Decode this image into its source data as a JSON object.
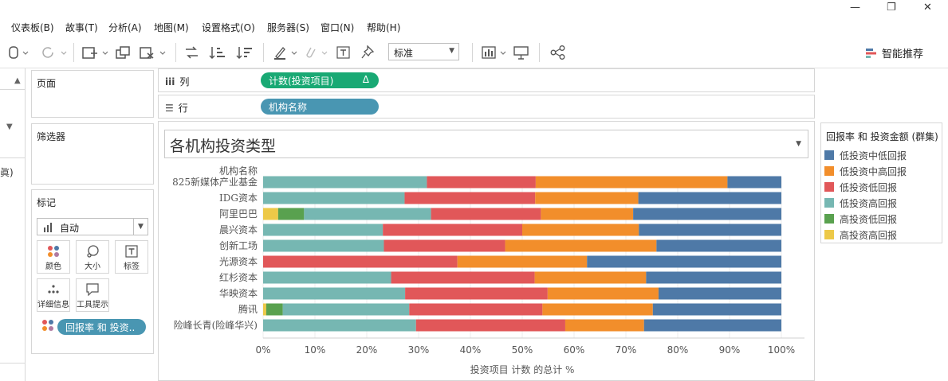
{
  "menu": [
    "仪表板(B)",
    "故事(T)",
    "分析(A)",
    "地图(M)",
    "设置格式(O)",
    "服务器(S)",
    "窗口(N)",
    "帮助(H)"
  ],
  "window_controls": [
    "—",
    "❐",
    "✕"
  ],
  "toolbar": {
    "mark_type_select": "标准",
    "smart_label": "智能推荐"
  },
  "left_strip": {
    "label": "眞)"
  },
  "panels": {
    "pages_title": "页面",
    "filters_title": "筛选器",
    "marks_title": "标记",
    "marks_type": "自动",
    "mark_buttons": [
      "颜色",
      "大小",
      "标签",
      "详细信息",
      "工具提示"
    ],
    "marks_pill": "回报率 和 投资.."
  },
  "shelves": {
    "columns_label": "列",
    "columns_pill": "计数(投资项目)",
    "columns_pill_delta": "Δ",
    "rows_label": "行",
    "rows_pill": "机构名称"
  },
  "viz": {
    "title": "各机构投资类型"
  },
  "legend": {
    "title": "回报率 和 投资金额 (群集)",
    "items": [
      {
        "label": "低投资中低回报",
        "color": "#4e79a7"
      },
      {
        "label": "低投资中高回报",
        "color": "#f28e2b"
      },
      {
        "label": "低投资低回报",
        "color": "#e15759"
      },
      {
        "label": "低投资高回报",
        "color": "#76b7b2"
      },
      {
        "label": "高投资低回报",
        "color": "#59a14f"
      },
      {
        "label": "高投资高回报",
        "color": "#edc948"
      }
    ]
  },
  "chart_data": {
    "type": "bar",
    "orientation": "horizontal",
    "stacked": "percent",
    "row_header": "机构名称",
    "xlabel": "投资项目 计数 的总计 %",
    "xlim": [
      0,
      100
    ],
    "x_ticks": [
      "0%",
      "10%",
      "20%",
      "30%",
      "40%",
      "50%",
      "60%",
      "70%",
      "80%",
      "90%",
      "100%"
    ],
    "categories": [
      "825新媒体产业基金",
      "IDG资本",
      "阿里巴巴",
      "晨兴资本",
      "创新工场",
      "光源资本",
      "红杉资本",
      "华映资本",
      "腾讯",
      "险峰长青(险峰华兴)"
    ],
    "stack_order": [
      "高投资高回报",
      "高投资低回报",
      "低投资高回报",
      "低投资低回报",
      "低投资中高回报",
      "低投资中低回报"
    ],
    "series": [
      {
        "name": "高投资高回报",
        "color": "#edc948",
        "values": [
          0,
          0,
          2.9,
          0,
          0,
          0,
          0,
          0,
          0.6,
          0
        ]
      },
      {
        "name": "高投资低回报",
        "color": "#59a14f",
        "values": [
          0,
          0,
          5.0,
          0,
          0,
          0,
          0,
          0,
          3.2,
          0
        ]
      },
      {
        "name": "低投资高回报",
        "color": "#76b7b2",
        "values": [
          31.6,
          27.3,
          24.5,
          23.1,
          23.3,
          0,
          24.7,
          27.4,
          24.4,
          29.5
        ]
      },
      {
        "name": "低投资低回报",
        "color": "#e15759",
        "values": [
          21.0,
          25.2,
          21.2,
          26.9,
          23.4,
          37.5,
          27.7,
          27.5,
          25.7,
          28.8
        ]
      },
      {
        "name": "低投资中高回报",
        "color": "#f28e2b",
        "values": [
          37.0,
          19.9,
          17.8,
          22.5,
          29.2,
          25.0,
          21.5,
          21.4,
          21.3,
          15.2
        ]
      },
      {
        "name": "低投资中低回报",
        "color": "#4e79a7",
        "values": [
          10.4,
          27.6,
          28.6,
          27.5,
          24.1,
          37.5,
          26.1,
          23.7,
          24.8,
          26.5
        ]
      }
    ]
  }
}
